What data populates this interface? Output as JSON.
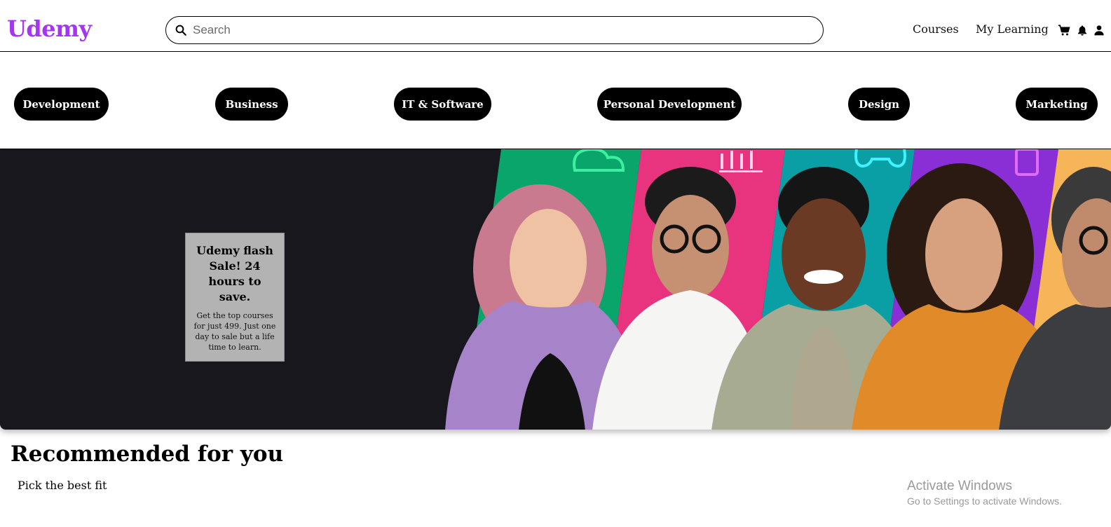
{
  "header": {
    "logo": "Udemy",
    "search_placeholder": "Search",
    "nav": {
      "courses": "Courses",
      "my_learning": "My Learning"
    },
    "icons": [
      "search-icon",
      "cart-icon",
      "bell-icon",
      "user-icon"
    ]
  },
  "categories": [
    {
      "label": "Development"
    },
    {
      "label": "Business"
    },
    {
      "label": "IT & Software"
    },
    {
      "label": "Personal Development"
    },
    {
      "label": "Design"
    },
    {
      "label": "Marketing"
    }
  ],
  "banner": {
    "promo_title": "Udemy flash Sale! 24 hours to save.",
    "promo_text": "Get the top courses for just 499. Just one day to sale but a life time to learn."
  },
  "recommended": {
    "title": "Recommended for you",
    "subtitle": "Pick the best fit"
  },
  "watermark": {
    "title": "Activate Windows",
    "subtitle": "Go to Settings to activate Windows."
  },
  "colors": {
    "brand": "#a435f0",
    "banner_bg": "#17171d",
    "chip_bg": "#000000",
    "promo_bg": "#b3b3b3"
  }
}
